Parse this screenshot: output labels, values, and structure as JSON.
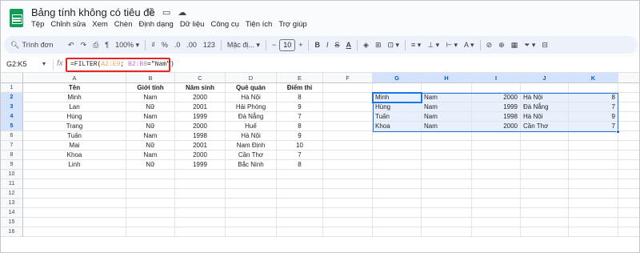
{
  "app": {
    "doc_title": "Bảng tính không có tiêu đề",
    "menu": [
      "Tệp",
      "Chỉnh sửa",
      "Xem",
      "Chèn",
      "Định dạng",
      "Dữ liệu",
      "Công cụ",
      "Tiện ích",
      "Trợ giúp"
    ]
  },
  "toolbar": {
    "search_label": "Trình đơn",
    "zoom": "100%",
    "percent": "%",
    "dec_decrease": ".0",
    "dec_increase": ".00",
    "number_format": "123",
    "font_family": "Mặc đị...",
    "font_size": "10",
    "bold": "B",
    "italic": "I",
    "strike": "S",
    "text_color": "A",
    "minus": "−",
    "plus": "+"
  },
  "formula_bar": {
    "name_box": "G2:K5",
    "fx": "fx",
    "formula_prefix": "=FILTER(",
    "range_a": "A2:E9",
    "formula_mid": "; ",
    "range_b": "B2:B9",
    "formula_suffix": "=\"Nam\")"
  },
  "columns": [
    "A",
    "B",
    "C",
    "D",
    "E",
    "F",
    "G",
    "H",
    "I",
    "J",
    "K"
  ],
  "rows": [
    "1",
    "2",
    "3",
    "4",
    "5",
    "6",
    "7",
    "8",
    "9",
    "10",
    "11",
    "12",
    "13",
    "14",
    "15",
    "16"
  ],
  "headers": [
    "Tên",
    "Giới tính",
    "Năm sinh",
    "Quê quán",
    "Điểm thi"
  ],
  "table": [
    [
      "Minh",
      "Nam",
      "2000",
      "Hà Nội",
      "8"
    ],
    [
      "Lan",
      "Nữ",
      "2001",
      "Hải Phòng",
      "9"
    ],
    [
      "Hùng",
      "Nam",
      "1999",
      "Đà Nẵng",
      "7"
    ],
    [
      "Trang",
      "Nữ",
      "2000",
      "Huế",
      "8"
    ],
    [
      "Tuấn",
      "Nam",
      "1998",
      "Hà Nội",
      "9"
    ],
    [
      "Mai",
      "Nữ",
      "2001",
      "Nam Định",
      "10"
    ],
    [
      "Khoa",
      "Nam",
      "2000",
      "Cần Thơ",
      "7"
    ],
    [
      "Linh",
      "Nữ",
      "1999",
      "Bắc Ninh",
      "8"
    ]
  ],
  "filter_result": [
    [
      "Minh",
      "Nam",
      "2000",
      "Hà Nội",
      "8"
    ],
    [
      "Hùng",
      "Nam",
      "1999",
      "Đà Nẵng",
      "7"
    ],
    [
      "Tuấn",
      "Nam",
      "1998",
      "Hà Nội",
      "9"
    ],
    [
      "Khoa",
      "Nam",
      "2000",
      "Cần Thơ",
      "7"
    ]
  ],
  "colors": {
    "selection": "#1a73e8",
    "formula_highlight": "#e62424",
    "range_a_color": "#f0a35b",
    "range_b_color": "#c26fd1"
  }
}
